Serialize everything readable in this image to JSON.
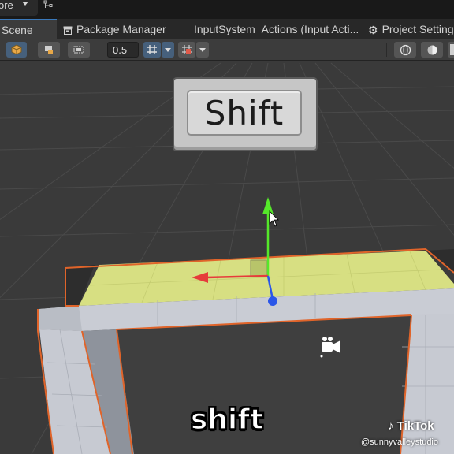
{
  "topbar": {
    "store_label": "ore"
  },
  "tabs": [
    {
      "label": "Scene",
      "active": true,
      "icon": "grid-icon"
    },
    {
      "label": "Package Manager",
      "active": false,
      "icon": "package-icon"
    },
    {
      "label": "InputSystem_Actions (Input Acti...",
      "active": false,
      "icon": ""
    },
    {
      "label": "Project Settings",
      "active": false,
      "icon": "gear-icon"
    }
  ],
  "toolbar": {
    "snap_increment": "0.5",
    "tools": [
      "cube-tool-icon",
      "hand-tool-icon",
      "rect-tool-icon",
      "grid-snap-icon",
      "snap-settings-icon",
      "sphere-icon",
      "shading-icon"
    ]
  },
  "scene": {
    "key_label": "Shift",
    "gizmo_axes": [
      "y-axis-green",
      "x-axis-red",
      "z-axis-blue"
    ],
    "camera_icon": "scene-camera-icon"
  },
  "overlay": {
    "caption": "shift",
    "brand": "TikTok",
    "handle": "@sunnyvalleystudio"
  },
  "colors": {
    "scene_bg": "#3a3a3a",
    "selection_outline": "#e0642a",
    "selected_face": "#d7df82",
    "tab_accent": "#3a79bb"
  }
}
